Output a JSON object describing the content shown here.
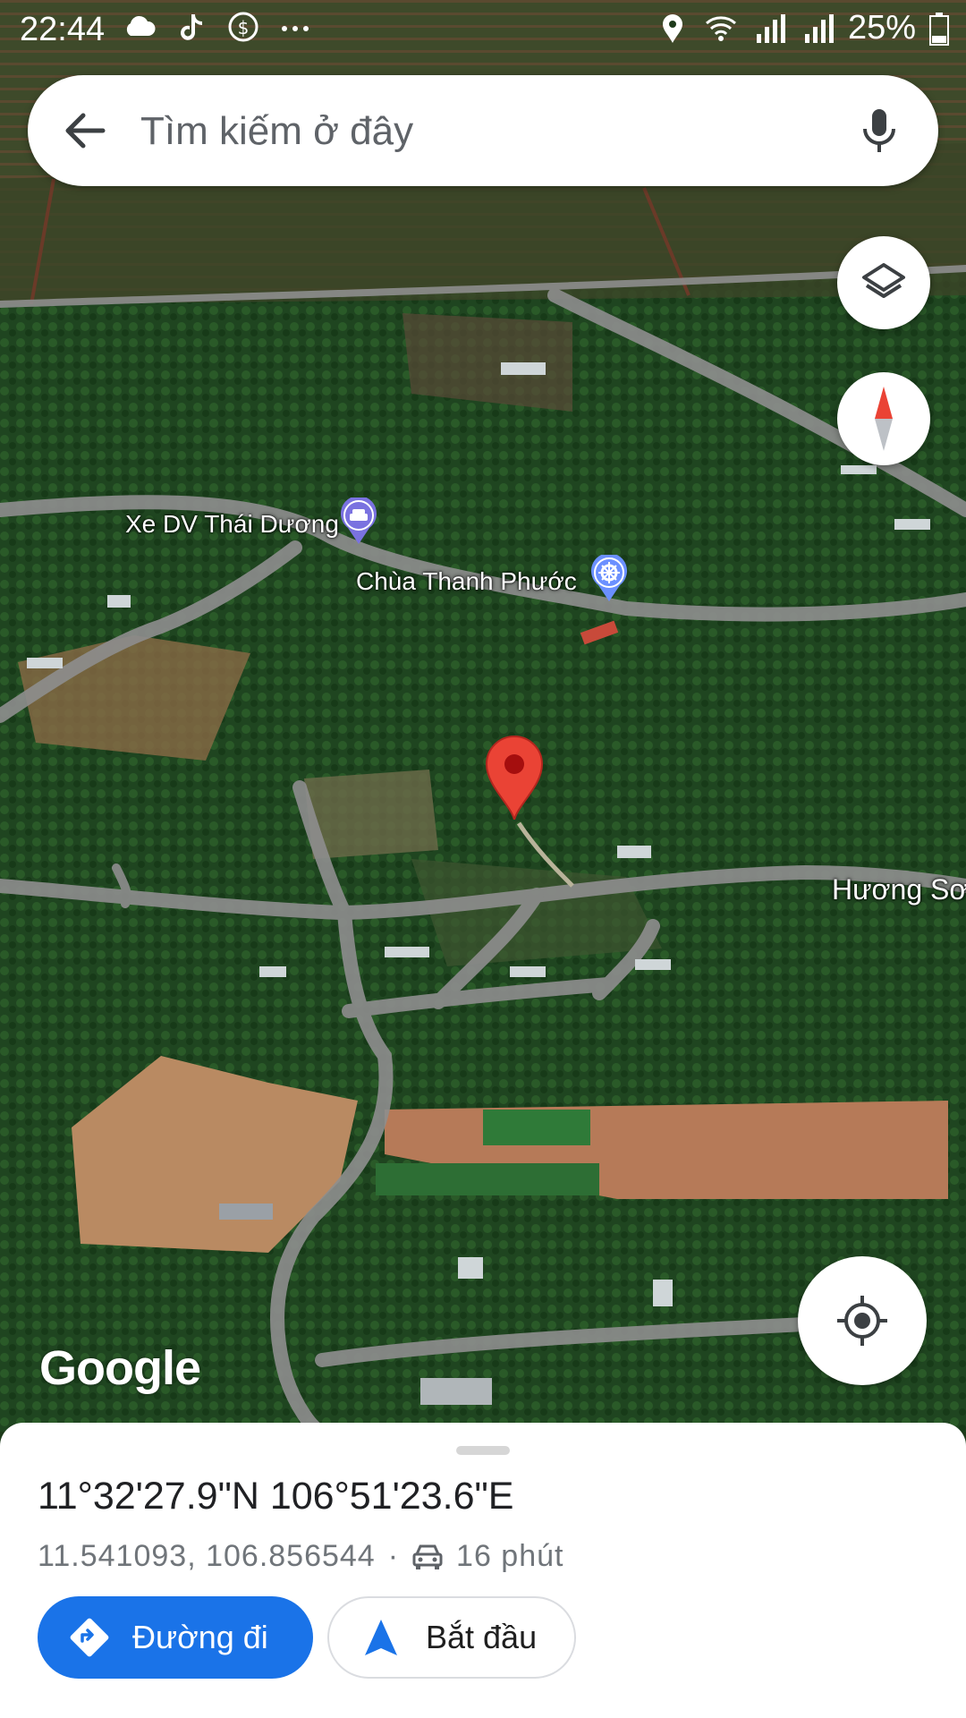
{
  "status_bar": {
    "time": "22:44",
    "battery": "25%"
  },
  "search": {
    "placeholder": "Tìm kiếm ở đây"
  },
  "map": {
    "places": [
      {
        "name": "Xe DV Thái Dương",
        "icon": "car-rental-icon"
      },
      {
        "name": "Chùa Thanh Phước",
        "icon": "temple-icon"
      },
      {
        "name": "Hương Sơ",
        "icon": ""
      }
    ],
    "logo": "Google",
    "pin_color": "#ea4335"
  },
  "sheet": {
    "coordinates_dms": "11°32'27.9\"N 106°51'23.6\"E",
    "coordinates_decimal": "11.541093, 106.856544",
    "separator": "·",
    "travel_time": "16 phút",
    "directions_label": "Đường đi",
    "start_label": "Bắt đầu"
  },
  "colors": {
    "accent": "#1a73e8",
    "poi_purple": "#7a72e0",
    "poi_blue": "#6b90ff"
  }
}
